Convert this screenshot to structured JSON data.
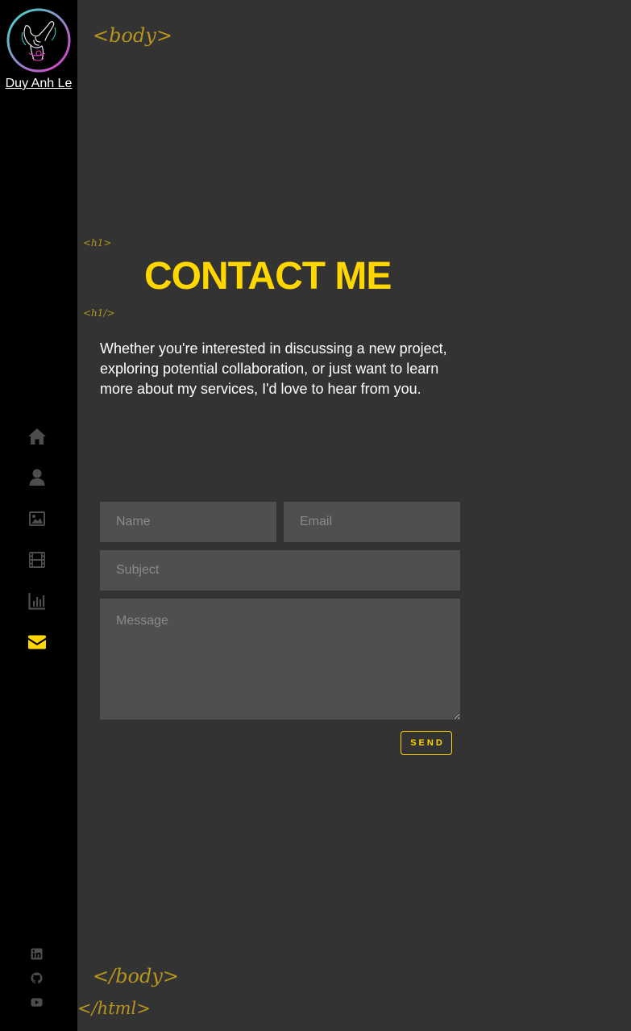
{
  "sidebar": {
    "logo_name": "Duy Anh Le",
    "nav": [
      {
        "icon": "home-icon",
        "color": "#4d4d4d"
      },
      {
        "icon": "user-icon",
        "color": "#4d4d4d"
      },
      {
        "icon": "image-icon",
        "color": "#4d4d4d"
      },
      {
        "icon": "film-icon",
        "color": "#4d4d4d"
      },
      {
        "icon": "chart-icon",
        "color": "#4d4d4d"
      },
      {
        "icon": "envelope-icon",
        "color": "#ffd700",
        "active": true
      }
    ],
    "socials": [
      {
        "icon": "linkedin-icon"
      },
      {
        "icon": "github-icon"
      },
      {
        "icon": "youtube-icon"
      }
    ]
  },
  "tags": {
    "body_open": "<body>",
    "h1_open": "<h1>",
    "h1_close": "<h1/>",
    "body_close": "</body>",
    "html_close": "</html>"
  },
  "contact": {
    "title": "CONTACT ME",
    "intro": "Whether you're interested in discussing a new project, exploring potential collaboration, or just want to learn more about my services, I'd love to hear from you."
  },
  "form": {
    "name_placeholder": "Name",
    "email_placeholder": "Email",
    "subject_placeholder": "Subject",
    "message_placeholder": "Message",
    "send_label": "SEND"
  },
  "colors": {
    "accent": "#ffd700",
    "tag": "#b8951c",
    "background": "#333333",
    "sidebar": "#000000",
    "field": "#4f4f4f",
    "icon_inactive": "#4d4d4d"
  }
}
